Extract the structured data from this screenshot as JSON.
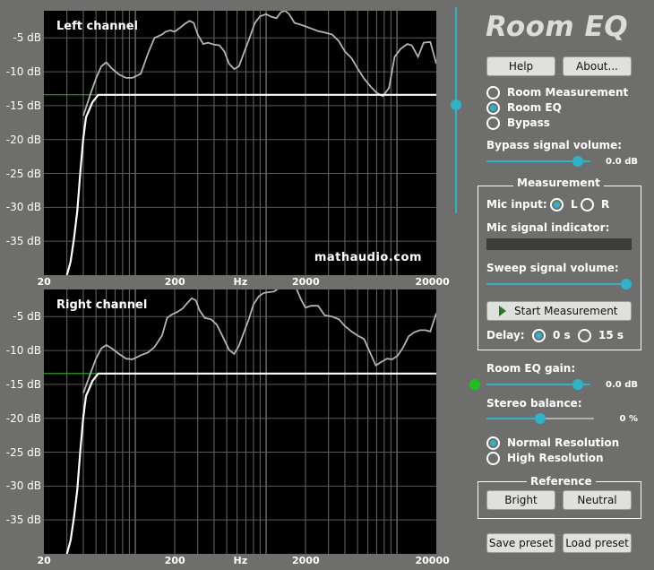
{
  "app": {
    "title": "Room EQ"
  },
  "header_buttons": {
    "help": "Help",
    "about": "About..."
  },
  "mode_options": [
    {
      "label": "Room Measurement",
      "selected": false
    },
    {
      "label": "Room EQ",
      "selected": true
    },
    {
      "label": "Bypass",
      "selected": false
    }
  ],
  "bypass": {
    "label": "Bypass signal volume:",
    "value": "0.0 dB",
    "fraction": 0.88
  },
  "master_slider": {
    "fraction": 0.56
  },
  "measurement": {
    "title": "Measurement",
    "mic_input_label": "Mic input:",
    "mic_options": [
      {
        "label": "L",
        "selected": true
      },
      {
        "label": "R",
        "selected": false
      }
    ],
    "mic_indicator_label": "Mic signal indicator:",
    "sweep_label": "Sweep signal volume:",
    "sweep_fraction": 1.0,
    "start_button": "Start Measurement",
    "delay_label": "Delay:",
    "delay_options": [
      {
        "label": "0 s",
        "selected": true
      },
      {
        "label": "15 s",
        "selected": false
      }
    ]
  },
  "room_eq_gain": {
    "label": "Room EQ gain:",
    "value": "0.0 dB",
    "fraction": 0.88
  },
  "stereo_balance": {
    "label": "Stereo balance:",
    "value": "0 %",
    "fraction": 0.5
  },
  "resolution_options": [
    {
      "label": "Normal Resolution",
      "selected": true
    },
    {
      "label": "High Resolution",
      "selected": false
    }
  ],
  "reference": {
    "title": "Reference",
    "bright": "Bright",
    "neutral": "Neutral"
  },
  "footer_buttons": {
    "save": "Save preset",
    "load": "Load preset"
  },
  "watermark": "mathaudio.com",
  "colors": {
    "accent": "#2bb3c8",
    "background": "#6e6e6c",
    "plot_bg": "#000000",
    "green_dot": "#1cc21c"
  },
  "chart_data": [
    {
      "type": "line",
      "title": "Left channel",
      "x_scale": "log",
      "xlim": [
        20,
        20000
      ],
      "x_ticks": [
        "20",
        "200",
        "Hz",
        "2000",
        "20000"
      ],
      "ylim": [
        -40,
        -1
      ],
      "y_ticks": [
        "-5 dB",
        "-10 dB",
        "-15 dB",
        "-20 dB",
        "-25 dB",
        "-30 dB",
        "-35 dB"
      ],
      "y_tick_values": [
        -5,
        -10,
        -15,
        -20,
        -25,
        -30,
        -35
      ],
      "grid": true,
      "reference_level": -13.4,
      "series": [
        {
          "color": "#b4b4b4",
          "x": [
            40,
            45,
            50,
            55,
            60,
            66,
            75,
            85,
            95,
            110,
            125,
            140,
            160,
            170,
            185,
            200,
            220,
            240,
            260,
            280,
            300,
            330,
            360,
            400,
            440,
            480,
            520,
            570,
            620,
            680,
            740,
            820,
            900,
            1000,
            1100,
            1200,
            1300,
            1400,
            1500,
            1650,
            1800,
            2000,
            2200,
            2500,
            2800,
            3200,
            3600,
            4000,
            4500,
            5000,
            5600,
            6300,
            7000,
            7800,
            8700,
            9600,
            10700,
            12000,
            13000,
            14500,
            16000,
            18000,
            20000
          ],
          "y": [
            -16.5,
            -13.5,
            -11.0,
            -9.2,
            -8.6,
            -9.5,
            -10.4,
            -10.9,
            -10.9,
            -10.3,
            -7.3,
            -5.0,
            -4.5,
            -4.1,
            -3.9,
            -4.1,
            -3.5,
            -2.9,
            -2.5,
            -2.8,
            -4.5,
            -5.9,
            -5.7,
            -6.0,
            -6.1,
            -7.0,
            -8.8,
            -9.6,
            -9.2,
            -7.1,
            -5.2,
            -2.8,
            -1.8,
            -1.5,
            -1.9,
            -2.1,
            -1.2,
            -1.0,
            -1.5,
            -2.8,
            -3.0,
            -3.3,
            -3.6,
            -4.0,
            -4.2,
            -4.5,
            -5.5,
            -7.0,
            -8.0,
            -9.5,
            -11.0,
            -12.2,
            -13.1,
            -13.6,
            -12.4,
            -7.8,
            -6.6,
            -5.9,
            -6.1,
            -7.8,
            -5.7,
            -5.6,
            -8.8
          ]
        },
        {
          "color": "#ffffff",
          "x": [
            30,
            32,
            34,
            36,
            38,
            40,
            42,
            44,
            47,
            52,
            20000
          ],
          "y": [
            -40,
            -38,
            -34.6,
            -30.5,
            -24.7,
            -19.8,
            -16.7,
            -15.8,
            -14.5,
            -13.4,
            -13.4
          ]
        }
      ]
    },
    {
      "type": "line",
      "title": "Right channel",
      "x_scale": "log",
      "xlim": [
        20,
        20000
      ],
      "x_ticks": [
        "20",
        "200",
        "Hz",
        "2000",
        "20000"
      ],
      "ylim": [
        -40,
        -1
      ],
      "y_ticks": [
        "-5 dB",
        "-10 dB",
        "-15 dB",
        "-20 dB",
        "-25 dB",
        "-30 dB",
        "-35 dB"
      ],
      "y_tick_values": [
        -5,
        -10,
        -15,
        -20,
        -25,
        -30,
        -35
      ],
      "grid": true,
      "reference_level": -13.4,
      "series": [
        {
          "color": "#b4b4b4",
          "x": [
            40,
            45,
            50,
            55,
            60,
            66,
            75,
            85,
            95,
            110,
            125,
            140,
            160,
            175,
            190,
            210,
            230,
            250,
            270,
            290,
            310,
            340,
            380,
            420,
            470,
            520,
            570,
            620,
            680,
            740,
            800,
            880,
            960,
            1050,
            1150,
            1250,
            1350,
            1450,
            1550,
            1700,
            1850,
            2000,
            2200,
            2500,
            2800,
            3200,
            3600,
            4000,
            4500,
            5000,
            5600,
            6200,
            6900,
            7600,
            8400,
            9200,
            10100,
            11100,
            12300,
            13600,
            15000,
            16500,
            18000,
            20000
          ],
          "y": [
            -16.3,
            -13.6,
            -11.2,
            -9.7,
            -9.2,
            -9.7,
            -10.5,
            -11.2,
            -11.3,
            -10.7,
            -10.3,
            -9.5,
            -7.8,
            -5.2,
            -4.7,
            -4.3,
            -3.8,
            -3.0,
            -2.3,
            -2.6,
            -4.1,
            -5.2,
            -5.4,
            -6.2,
            -8.1,
            -9.9,
            -10.5,
            -9.3,
            -7.2,
            -5.3,
            -3.2,
            -2.0,
            -1.5,
            -1.4,
            -1.3,
            -0.8,
            -0.6,
            -0.7,
            -0.7,
            -0.8,
            -2.5,
            -3.7,
            -3.4,
            -3.4,
            -4.8,
            -5.0,
            -5.4,
            -6.4,
            -7.2,
            -7.8,
            -8.3,
            -10.2,
            -12.2,
            -11.7,
            -11.2,
            -11.3,
            -10.8,
            -9.6,
            -7.9,
            -7.3,
            -7.0,
            -7.0,
            -7.2,
            -4.5
          ]
        },
        {
          "color": "#ffffff",
          "x": [
            30,
            32,
            34,
            36,
            38,
            40,
            42,
            44,
            47,
            52,
            20000
          ],
          "y": [
            -40,
            -38,
            -34.6,
            -30.5,
            -24.7,
            -19.8,
            -16.7,
            -15.8,
            -14.5,
            -13.4,
            -13.4
          ]
        }
      ]
    }
  ]
}
